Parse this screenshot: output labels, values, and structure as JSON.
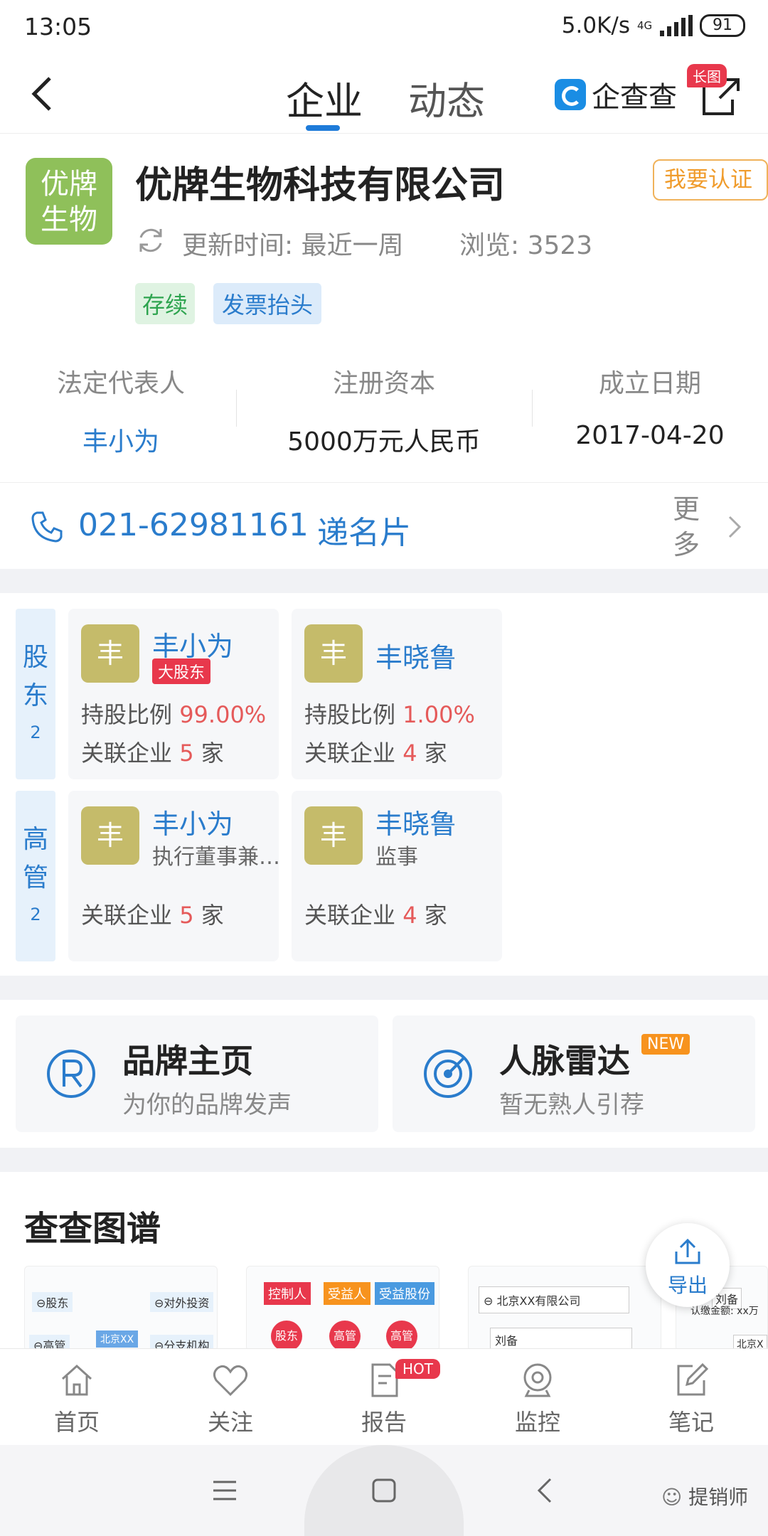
{
  "status": {
    "time": "13:05",
    "speed": "5.0K/s",
    "net": "4G",
    "battery": "91"
  },
  "nav": {
    "tab_enterprise": "企业",
    "tab_dynamic": "动态",
    "logo": "企查查",
    "long_image_badge": "长图"
  },
  "company": {
    "logo_text": "优牌\n生物",
    "name": "优牌生物科技有限公司",
    "cert_button": "我要认证",
    "update_time": "更新时间: 最近一周",
    "views": "浏览: 3523",
    "tag_status": "存续",
    "tag_invoice": "发票抬头"
  },
  "info": {
    "legal_rep_label": "法定代表人",
    "legal_rep_value": "丰小为",
    "capital_label": "注册资本",
    "capital_value": "5000万元人民币",
    "founded_label": "成立日期",
    "founded_value": "2017-04-20"
  },
  "contact": {
    "phone": "021-62981161",
    "card_link": "递名片",
    "more": "更多"
  },
  "shareholders": {
    "label": "股东",
    "count": "2",
    "items": [
      {
        "avatar": "丰",
        "name": "丰小为",
        "badge": "大股东",
        "ratio_label": "持股比例",
        "ratio": "99.00%",
        "assoc_label": "关联企业",
        "assoc_count": "5",
        "assoc_unit": "家"
      },
      {
        "avatar": "丰",
        "name": "丰晓鲁",
        "ratio_label": "持股比例",
        "ratio": "1.00%",
        "assoc_label": "关联企业",
        "assoc_count": "4",
        "assoc_unit": "家"
      }
    ]
  },
  "executives": {
    "label": "高管",
    "count": "2",
    "items": [
      {
        "avatar": "丰",
        "name": "丰小为",
        "role": "执行董事兼…",
        "assoc_label": "关联企业",
        "assoc_count": "5",
        "assoc_unit": "家"
      },
      {
        "avatar": "丰",
        "name": "丰晓鲁",
        "role": "监事",
        "assoc_label": "关联企业",
        "assoc_count": "4",
        "assoc_unit": "家"
      }
    ]
  },
  "features": {
    "brand_title": "品牌主页",
    "brand_sub": "为你的品牌发声",
    "radar_title": "人脉雷达",
    "radar_badge": "NEW",
    "radar_sub": "暂无熟人引荐"
  },
  "graph": {
    "title": "查查图谱",
    "thumb1": {
      "a": "⊖股东",
      "b": "⊖对外投资",
      "c": "⊖高管",
      "d": "北京XX",
      "e": "⊖分支机构"
    },
    "thumb2": {
      "a": "控制人",
      "b": "受益人",
      "c": "受益股份",
      "d": "股东",
      "e": "高管",
      "f": "高管"
    },
    "thumb3": {
      "a": "⊖ 北京XX有限公司",
      "b": "刘备"
    },
    "thumb4": {
      "a": "刘备",
      "b": "认缴金额: xx万",
      "c": "北京X"
    },
    "export": "导出"
  },
  "tabbar": {
    "home": "首页",
    "follow": "关注",
    "report": "报告",
    "report_badge": "HOT",
    "monitor": "监控",
    "notes": "笔记"
  },
  "watermark": "提销师",
  "colors": {
    "accent": "#2a7ccc",
    "tab_underline": "#1e7bd9",
    "logo_green": "#8fc05a",
    "avatar_olive": "#c5bb6a",
    "badge_red": "#e8384c"
  }
}
